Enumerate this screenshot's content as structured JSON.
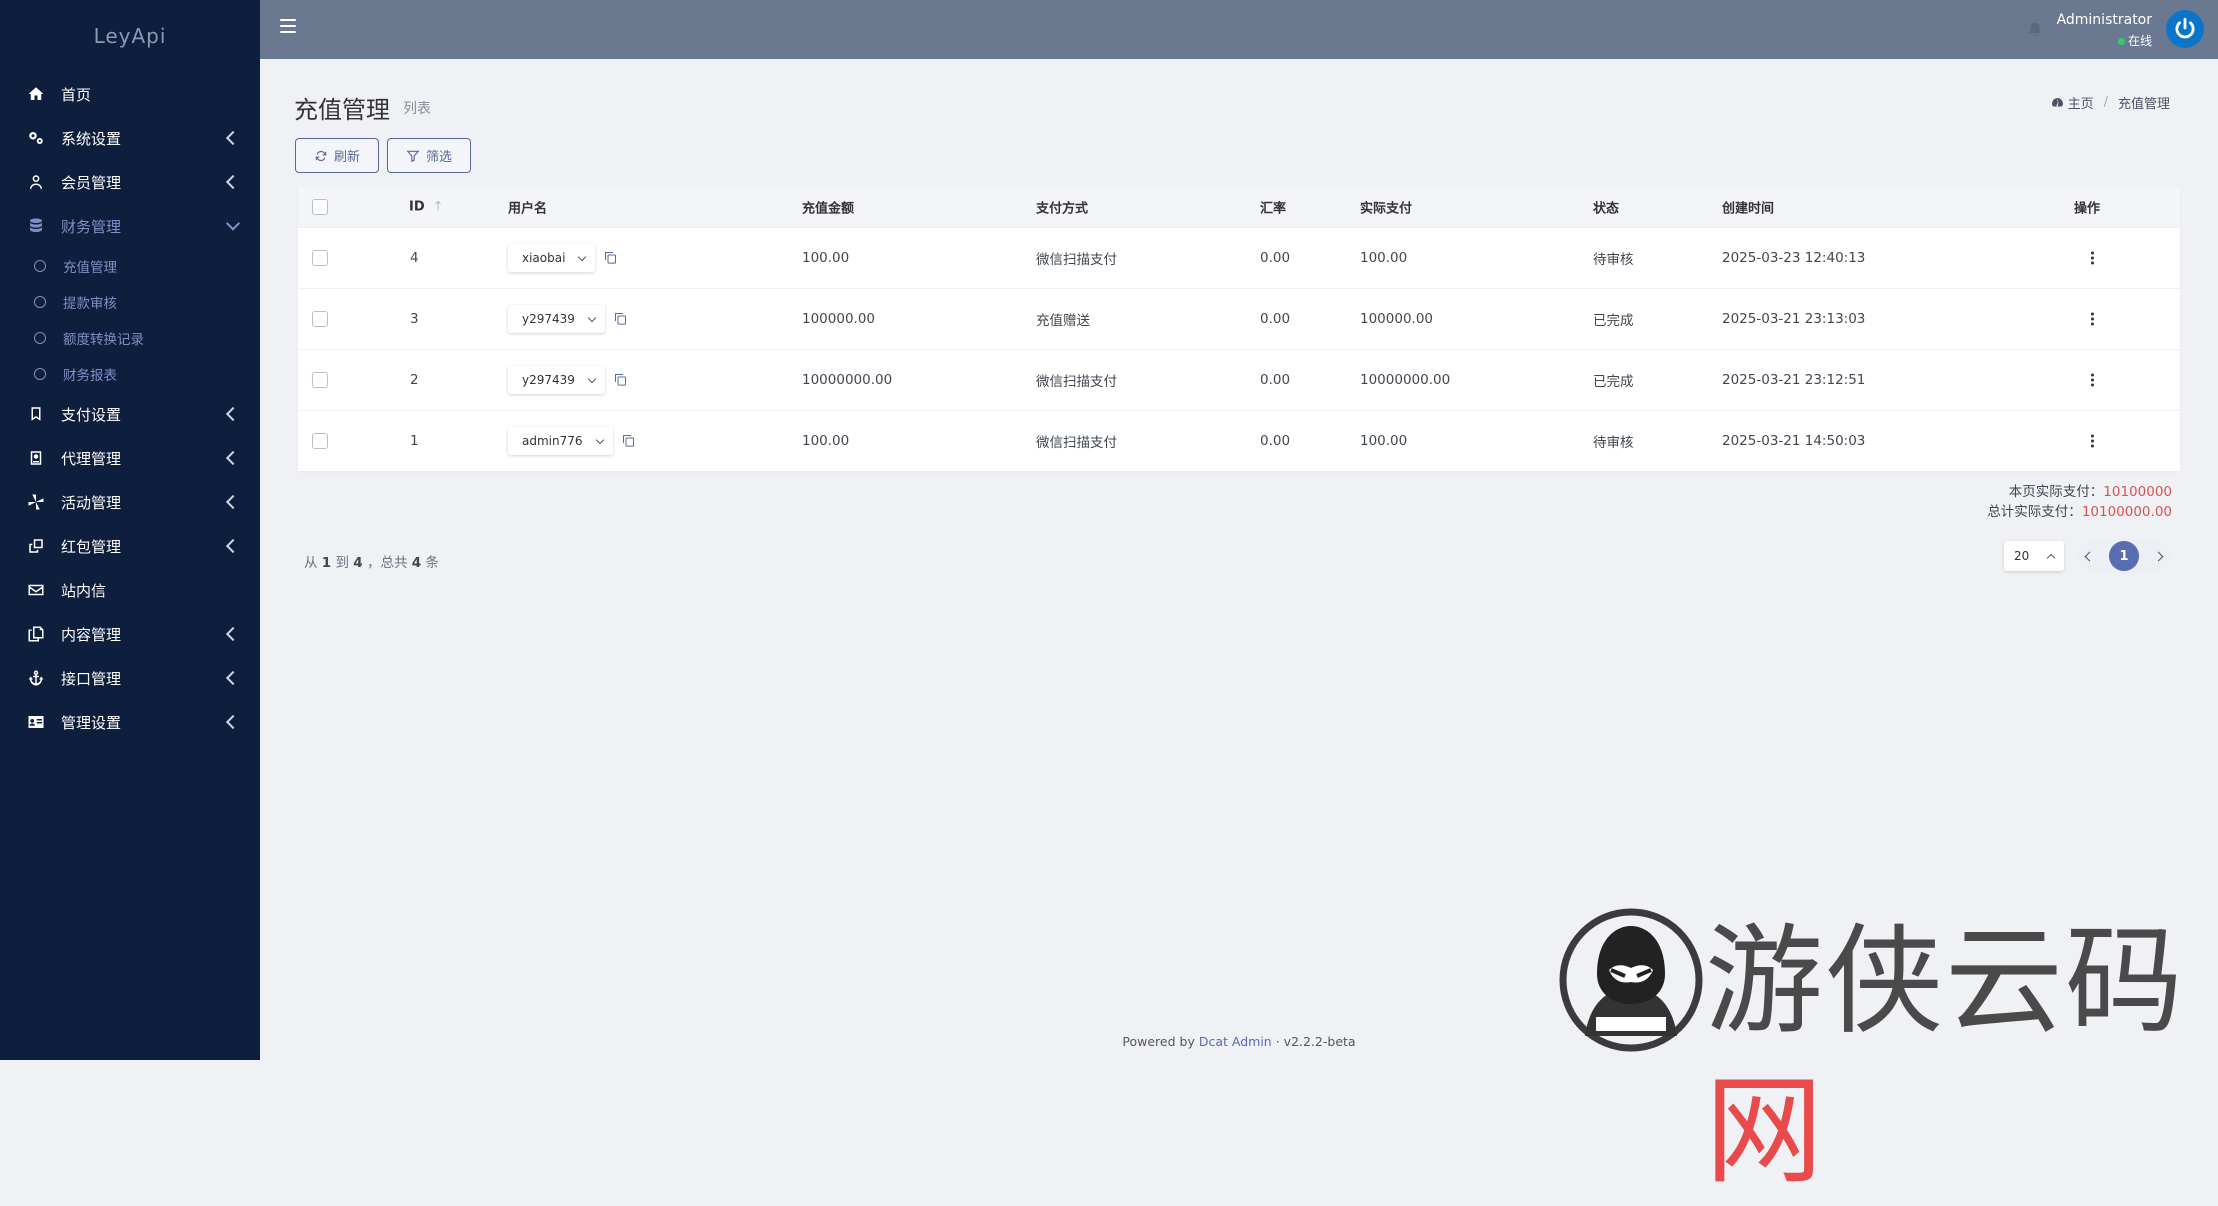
{
  "brand": "LeyApi",
  "sidebar": {
    "items": [
      {
        "label": "首页",
        "icon": "home-icon",
        "has_children": false
      },
      {
        "label": "系统设置",
        "icon": "cogs-icon",
        "has_children": true
      },
      {
        "label": "会员管理",
        "icon": "user-icon",
        "has_children": true
      },
      {
        "label": "财务管理",
        "icon": "database-icon",
        "has_children": true,
        "open": true
      },
      {
        "label": "支付设置",
        "icon": "bookmark-icon",
        "has_children": true
      },
      {
        "label": "代理管理",
        "icon": "id-badge-icon",
        "has_children": true
      },
      {
        "label": "活动管理",
        "icon": "pinwheel-icon",
        "has_children": true
      },
      {
        "label": "红包管理",
        "icon": "clone-icon",
        "has_children": true
      },
      {
        "label": "站内信",
        "icon": "envelope-icon",
        "has_children": false
      },
      {
        "label": "内容管理",
        "icon": "copy-icon",
        "has_children": true
      },
      {
        "label": "接口管理",
        "icon": "anchor-icon",
        "has_children": true
      },
      {
        "label": "管理设置",
        "icon": "id-card-icon",
        "has_children": true
      }
    ],
    "finance_sub": [
      "充值管理",
      "提款审核",
      "额度转换记录",
      "财务报表"
    ]
  },
  "navbar": {
    "user_name": "Administrator",
    "user_status": "在线"
  },
  "header": {
    "title": "充值管理",
    "subtitle": "列表",
    "breadcrumb_home": "主页",
    "breadcrumb_current": "充值管理"
  },
  "toolbar": {
    "refresh_label": "刷新",
    "filter_label": "筛选"
  },
  "table": {
    "columns": [
      "ID",
      "用户名",
      "充值金额",
      "支付方式",
      "汇率",
      "实际支付",
      "状态",
      "创建时间",
      "操作"
    ],
    "rows": [
      {
        "id": "4",
        "username": "xiaobai",
        "amount": "100.00",
        "method": "微信扫描支付",
        "rate": "0.00",
        "paid": "100.00",
        "status": "待审核",
        "created": "2025-03-23 12:40:13"
      },
      {
        "id": "3",
        "username": "y297439",
        "amount": "100000.00",
        "method": "充值赠送",
        "rate": "0.00",
        "paid": "100000.00",
        "status": "已完成",
        "created": "2025-03-21 23:13:03"
      },
      {
        "id": "2",
        "username": "y297439",
        "amount": "10000000.00",
        "method": "微信扫描支付",
        "rate": "0.00",
        "paid": "10000000.00",
        "status": "已完成",
        "created": "2025-03-21 23:12:51"
      },
      {
        "id": "1",
        "username": "admin776",
        "amount": "100.00",
        "method": "微信扫描支付",
        "rate": "0.00",
        "paid": "100.00",
        "status": "待审核",
        "created": "2025-03-21 14:50:03"
      }
    ]
  },
  "totals": {
    "page_label": "本页实际支付：",
    "page_value": "10100000",
    "total_label": "总计实际支付：",
    "total_value": "10100000.00"
  },
  "pagination": {
    "from_label": "从",
    "from": "1",
    "to_label": "到",
    "to": "4",
    "total_label": "，总共",
    "total": "4",
    "unit": "条",
    "per_page": "20",
    "current_page": "1"
  },
  "footer": {
    "powered_by": "Powered by",
    "product": "Dcat Admin",
    "dot": "·",
    "version": "v2.2.2-beta"
  },
  "watermark": {
    "text_main": "游侠云码",
    "text_accent": "网"
  },
  "colors": {
    "sidebar_bg": "#0e1e3d",
    "navbar_bg": "#6a7990",
    "accent": "#586cb1",
    "total_red": "#d9534f"
  }
}
